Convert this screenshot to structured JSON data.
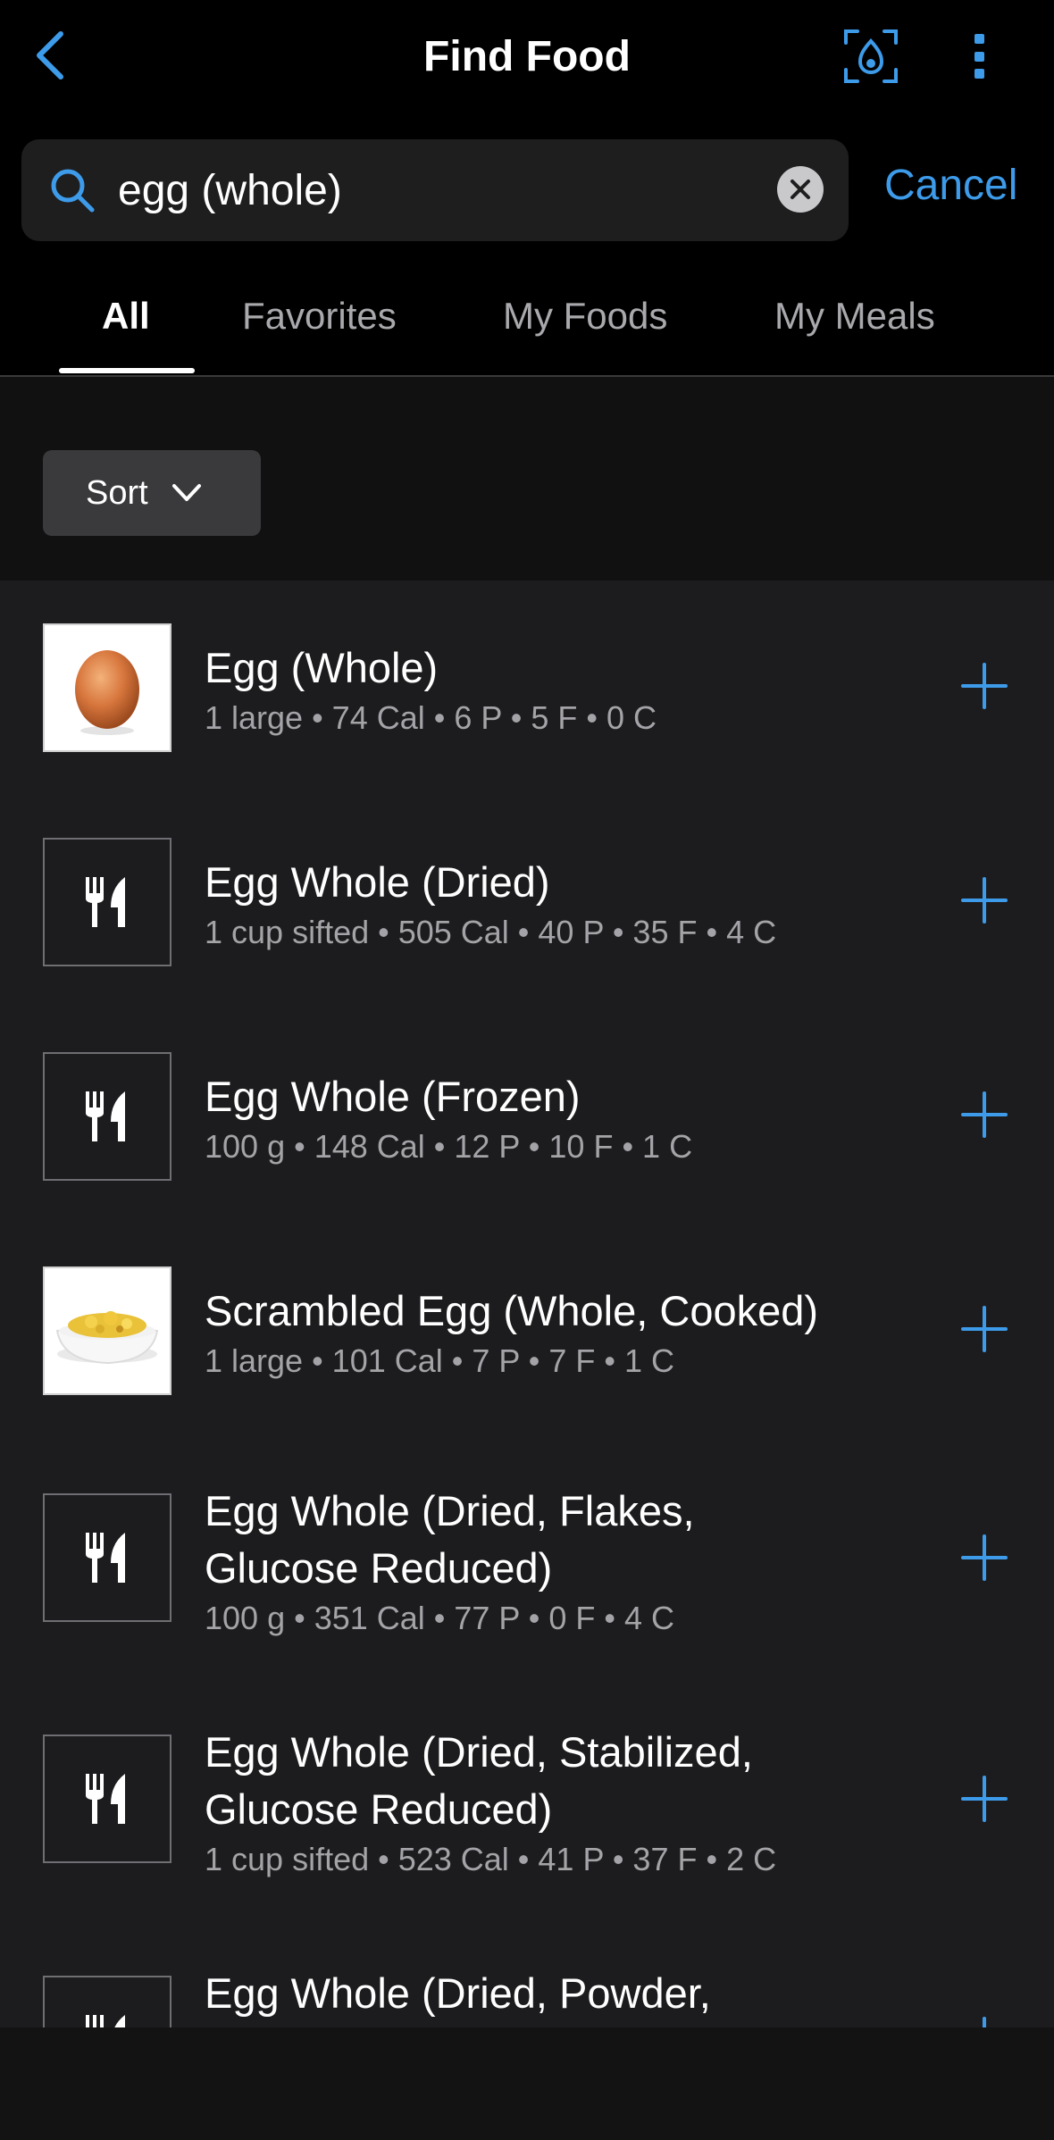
{
  "header": {
    "title": "Find Food",
    "back_icon": "chevron-left-icon",
    "scan_icon": "scan-icon",
    "more_icon": "more-vertical-icon"
  },
  "search": {
    "value": "egg (whole)",
    "placeholder": "",
    "cancel_label": "Cancel"
  },
  "tabs": [
    {
      "label": "All",
      "active": true
    },
    {
      "label": "Favorites",
      "active": false
    },
    {
      "label": "My Foods",
      "active": false
    },
    {
      "label": "My Meals",
      "active": false
    }
  ],
  "sort": {
    "label": "Sort"
  },
  "results": [
    {
      "name": "Egg (Whole)",
      "detail": "1 large • 74 Cal • 6 P • 5 F • 0 C",
      "thumb": "egg-photo"
    },
    {
      "name": "Egg Whole (Dried)",
      "detail": "1 cup sifted • 505 Cal • 40 P • 35 F • 4 C",
      "thumb": "utensils-icon"
    },
    {
      "name": "Egg Whole (Frozen)",
      "detail": "100 g • 148 Cal • 12 P • 10 F • 1 C",
      "thumb": "utensils-icon"
    },
    {
      "name": "Scrambled Egg (Whole, Cooked)",
      "detail": "1 large • 101 Cal • 7 P • 7 F • 1 C",
      "thumb": "scrambled-egg-photo"
    },
    {
      "name_line1": "Egg Whole (Dried, Flakes,",
      "name_line2": "Glucose Reduced)",
      "detail": "100 g • 351 Cal • 77 P • 0 F • 4 C",
      "thumb": "utensils-icon"
    },
    {
      "name_line1": "Egg Whole (Dried, Stabilized,",
      "name_line2": "Glucose Reduced)",
      "detail": "1 cup sifted • 523 Cal • 41 P • 37 F • 2 C",
      "thumb": "utensils-icon"
    },
    {
      "name_line1": "Egg Whole (Dried, Powder,",
      "thumb": "utensils-icon"
    }
  ],
  "colors": {
    "accent": "#3d9bea",
    "background": "#000000",
    "list_background": "#1c1c1e"
  }
}
